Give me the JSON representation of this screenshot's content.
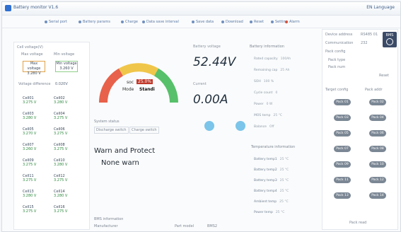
{
  "app": {
    "title": "Battery monitor V1.6",
    "right_label": "EN  Language"
  },
  "toolbar": [
    "Serial port",
    "Battery params",
    "Charge",
    "Data save interval",
    "Save data",
    "Download",
    "Reset",
    "Setting",
    "Alarm"
  ],
  "cell_voltage": {
    "title": "Cell voltage(V)",
    "max_label": "Max voltage",
    "min_label": "Min voltage",
    "max_value": "3.280 V",
    "min_value": "3.260 V",
    "diff_label": "Voltage difference",
    "diff_value": "0.020V",
    "cells": [
      {
        "name": "Cell01",
        "v": "3.275 V"
      },
      {
        "name": "Cell02",
        "v": "3.280 V"
      },
      {
        "name": "Cell03",
        "v": "3.280 V"
      },
      {
        "name": "Cell04",
        "v": "3.275 V"
      },
      {
        "name": "Cell05",
        "v": "3.270 V"
      },
      {
        "name": "Cell06",
        "v": "3.275 V"
      },
      {
        "name": "Cell07",
        "v": "3.260 V"
      },
      {
        "name": "Cell08",
        "v": "3.275 V"
      },
      {
        "name": "Cell09",
        "v": "3.275 V"
      },
      {
        "name": "Cell10",
        "v": "3.280 V"
      },
      {
        "name": "Cell11",
        "v": "3.275 V"
      },
      {
        "name": "Cell12",
        "v": "3.275 V"
      },
      {
        "name": "Cell13",
        "v": "3.280 V"
      },
      {
        "name": "Cell14",
        "v": "3.280 V"
      },
      {
        "name": "Cell15",
        "v": "3.275 V"
      },
      {
        "name": "Cell16",
        "v": "3.275 V"
      }
    ]
  },
  "gauge": {
    "soc_label": "soc",
    "soc_value": "25.0%",
    "mode_label": "Mode",
    "mode_value": "Standi",
    "level_fraction": 0.25
  },
  "system_status": {
    "title": "System status",
    "discharge": "Discharge switch",
    "charge": "Charge switch"
  },
  "warn": {
    "title": "Warn and Protect",
    "value": "None warn"
  },
  "battery": {
    "voltage_label": "Battery voltage",
    "voltage_value": "52.44V",
    "current_label": "Current",
    "current_value": "0.00A"
  },
  "battery_info": {
    "title": "Battery information",
    "rows": [
      {
        "k": "Rated capacity",
        "v": "100Ah"
      },
      {
        "k": "Remaining cap",
        "v": "25 Ah"
      },
      {
        "k": "SOH",
        "v": "100 %"
      },
      {
        "k": "Cycle count",
        "v": "0"
      },
      {
        "k": "Power",
        "v": "0 W"
      },
      {
        "k": "MOS temp",
        "v": "25 °C"
      },
      {
        "k": "Balance",
        "v": "Off"
      }
    ]
  },
  "temperature": {
    "title": "Temperature information",
    "rows": [
      {
        "k": "Battery temp1",
        "v": "25 °C"
      },
      {
        "k": "Battery temp2",
        "v": "25 °C"
      },
      {
        "k": "Battery temp3",
        "v": "25 °C"
      },
      {
        "k": "Battery temp4",
        "v": "25 °C"
      },
      {
        "k": "Ambient temp",
        "v": "25 °C"
      },
      {
        "k": "Power temp",
        "v": "25 °C"
      }
    ]
  },
  "comm": {
    "label": "BMS information",
    "manufacturer": "Manufacturer",
    "model": "Part model",
    "model_value": "BMS2"
  },
  "right": {
    "address_label": "Device address",
    "address_value": "RS485 01",
    "protocol_label": "Communication",
    "protocol_value": "232",
    "config_label": "Pack config",
    "pack_type": "Pack type",
    "pack_num": "Pack num",
    "reset_label": "Reset",
    "target_label": "Target config",
    "pack_addr": "Pack addr",
    "bms_label": "BMS",
    "packs": [
      "Pack 01",
      "Pack 02",
      "Pack 03",
      "Pack 04",
      "Pack 05",
      "Pack 06",
      "Pack 07",
      "Pack 08",
      "Pack 09",
      "Pack 10",
      "Pack 11",
      "Pack 12",
      "Pack 13",
      "Pack 14"
    ],
    "read_label": "Pack read"
  }
}
